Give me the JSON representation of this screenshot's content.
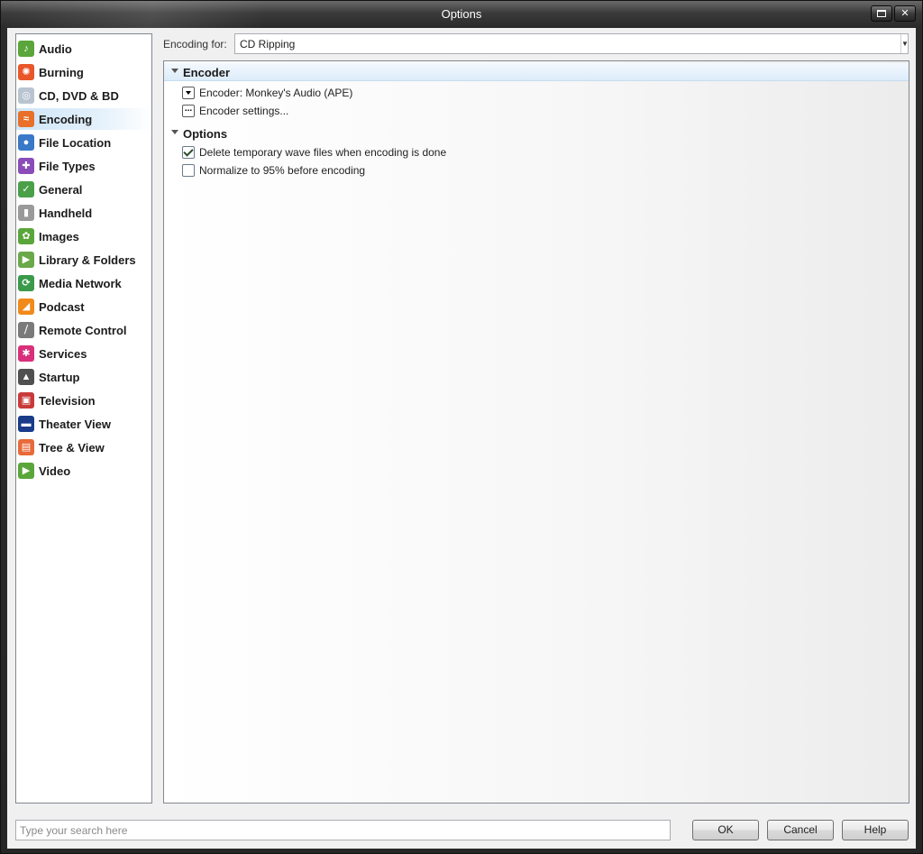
{
  "window": {
    "title": "Options"
  },
  "sidebar": {
    "items": [
      {
        "label": "Audio",
        "icon": "audio-icon",
        "color": "#5aa63a",
        "glyph": "♪"
      },
      {
        "label": "Burning",
        "icon": "flame-icon",
        "color": "#e8562a",
        "glyph": "✺"
      },
      {
        "label": "CD, DVD & BD",
        "icon": "disc-icon",
        "color": "#b8c4d0",
        "glyph": "◎"
      },
      {
        "label": "Encoding",
        "icon": "waveform-icon",
        "color": "#e8702a",
        "glyph": "≈",
        "selected": true
      },
      {
        "label": "File Location",
        "icon": "globe-icon",
        "color": "#3a78c8",
        "glyph": "●"
      },
      {
        "label": "File Types",
        "icon": "puzzle-icon",
        "color": "#8a4cb8",
        "glyph": "✚"
      },
      {
        "label": "General",
        "icon": "chart-icon",
        "color": "#4aa048",
        "glyph": "✓"
      },
      {
        "label": "Handheld",
        "icon": "device-icon",
        "color": "#9a9a9a",
        "glyph": "▮"
      },
      {
        "label": "Images",
        "icon": "image-icon",
        "color": "#5aa63a",
        "glyph": "✿"
      },
      {
        "label": "Library & Folders",
        "icon": "library-icon",
        "color": "#6aa84a",
        "glyph": "▶"
      },
      {
        "label": "Media Network",
        "icon": "network-icon",
        "color": "#3a9a4a",
        "glyph": "⟳"
      },
      {
        "label": "Podcast",
        "icon": "rss-icon",
        "color": "#f08a1a",
        "glyph": "◢"
      },
      {
        "label": "Remote Control",
        "icon": "remote-icon",
        "color": "#7a7a7a",
        "glyph": "⧸"
      },
      {
        "label": "Services",
        "icon": "services-icon",
        "color": "#d8307a",
        "glyph": "✱"
      },
      {
        "label": "Startup",
        "icon": "startup-icon",
        "color": "#505050",
        "glyph": "▲"
      },
      {
        "label": "Television",
        "icon": "tv-icon",
        "color": "#c83a3a",
        "glyph": "▣"
      },
      {
        "label": "Theater View",
        "icon": "theater-icon",
        "color": "#1a3a8a",
        "glyph": "▬"
      },
      {
        "label": "Tree & View",
        "icon": "tree-view-icon",
        "color": "#e86a3a",
        "glyph": "▤"
      },
      {
        "label": "Video",
        "icon": "video-icon",
        "color": "#5aa63a",
        "glyph": "▶"
      }
    ]
  },
  "encoding_for": {
    "label": "Encoding for:",
    "value": "CD Ripping"
  },
  "sections": {
    "encoder": {
      "title": "Encoder",
      "encoder_choice": "Encoder: Monkey's Audio (APE)",
      "encoder_settings": "Encoder settings...",
      "settings_glyph": "..."
    },
    "options": {
      "title": "Options",
      "delete_temp": {
        "label": "Delete temporary wave files when encoding is done",
        "checked": true
      },
      "normalize": {
        "label": "Normalize to 95% before encoding",
        "checked": false
      }
    }
  },
  "footer": {
    "search_placeholder": "Type your search here",
    "ok": "OK",
    "cancel": "Cancel",
    "help": "Help"
  },
  "titlebar_buttons": {
    "close_glyph": "✕"
  }
}
